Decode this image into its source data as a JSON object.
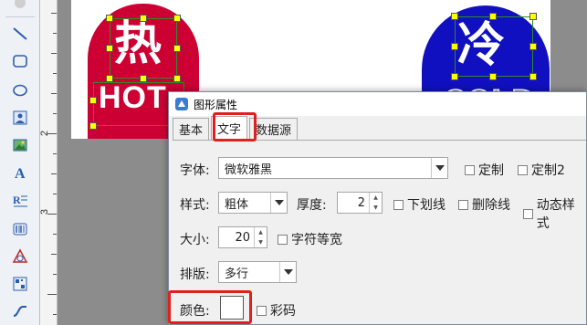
{
  "canvas": {
    "ruler_labels": [
      "2",
      "3"
    ],
    "hot": {
      "char": "热",
      "word": "HOT",
      "color": "#cc0033"
    },
    "cold": {
      "char": "冷",
      "word": "COLD",
      "color": "#1010c0"
    }
  },
  "dialog": {
    "title": "图形属性",
    "tabs": [
      "基本",
      "文字",
      "数据源"
    ],
    "active_tab": "文字",
    "font": {
      "label": "字体:",
      "value": "微软雅黑"
    },
    "custom1": "定制",
    "custom2": "定制2",
    "style": {
      "label": "样式:",
      "value": "粗体"
    },
    "thickness": {
      "label": "厚度:",
      "value": "2"
    },
    "underline": "下划线",
    "strikethrough": "删除线",
    "dynamic_style": "动态样式",
    "size": {
      "label": "大小:",
      "value": "20"
    },
    "equal_width": "字符等宽",
    "layout": {
      "label": "排版:",
      "value": "多行"
    },
    "color": {
      "label": "颜色:",
      "value": "#ffffff"
    },
    "color_code": "彩码"
  },
  "toolbar": {
    "tools": [
      "line-icon",
      "rounded-rect-icon",
      "ellipse-icon",
      "image-frame-icon",
      "picture-icon",
      "text-icon",
      "rich-text-icon",
      "barcode-icon",
      "shape-icon",
      "qrcode-icon",
      "curve-icon"
    ]
  }
}
